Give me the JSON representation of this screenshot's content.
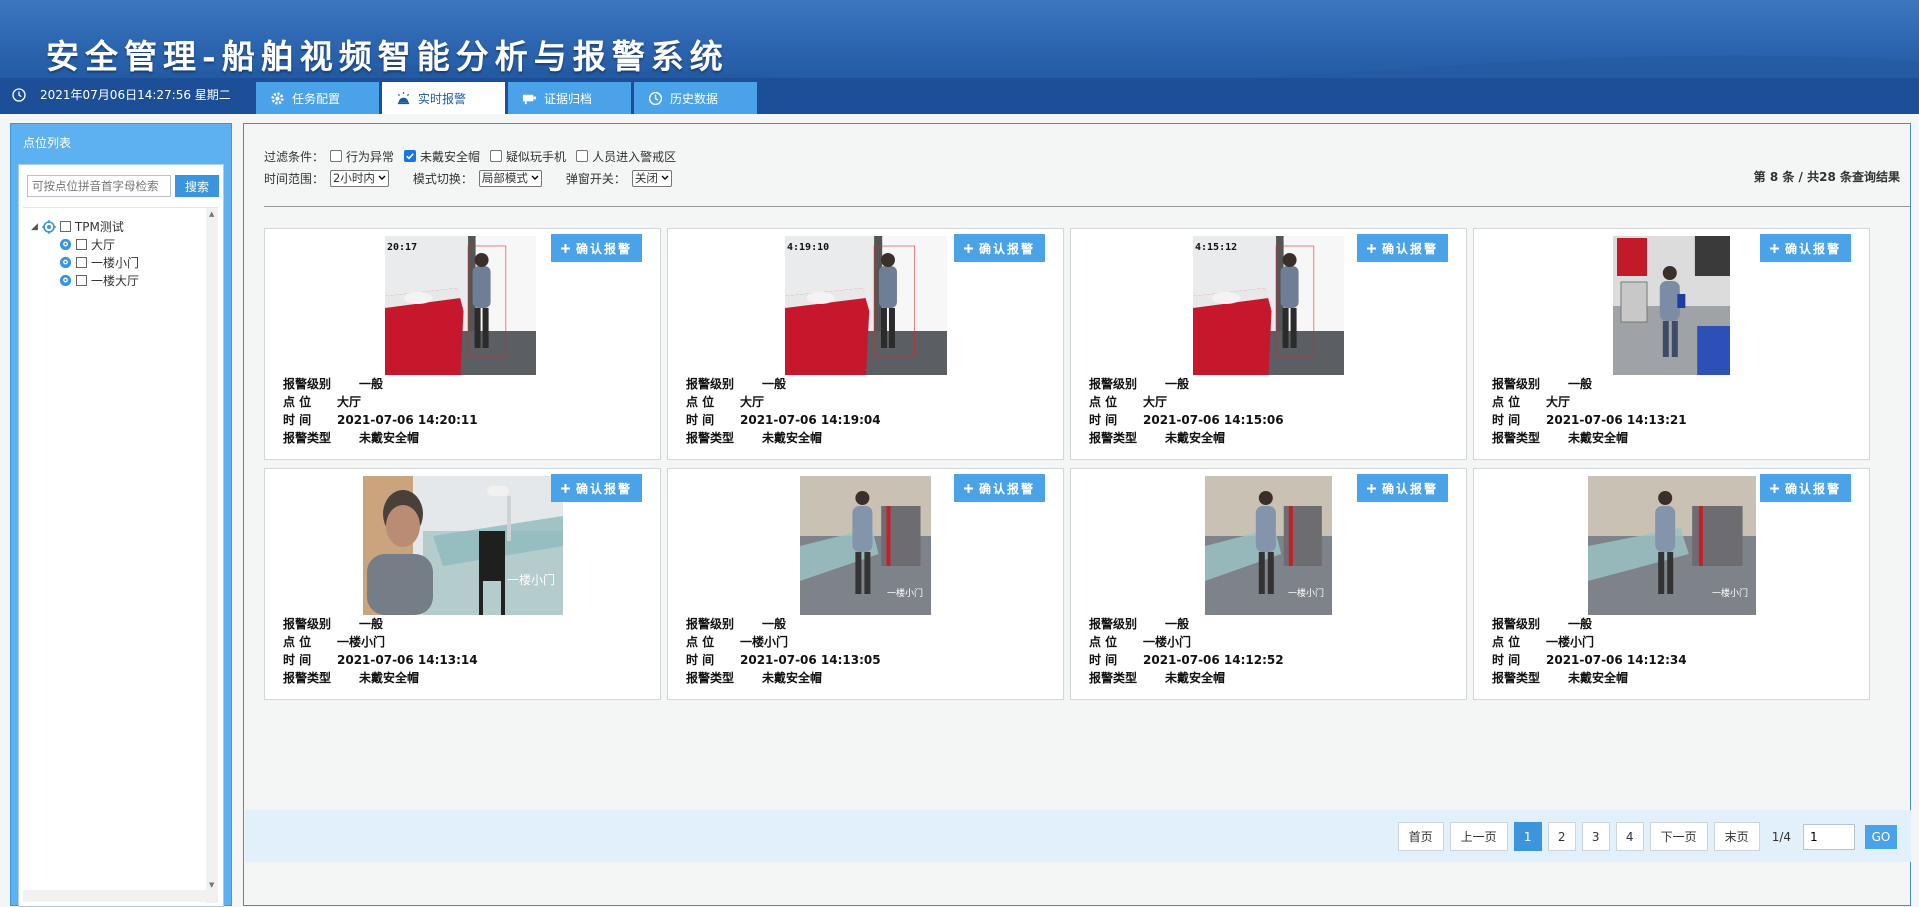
{
  "header": {
    "title": "安全管理-船舶视频智能分析与报警系统",
    "datetime": "2021年07月06日14:27:56 星期二"
  },
  "tabs": [
    {
      "label": "任务配置",
      "icon": "gear-icon"
    },
    {
      "label": "实时报警",
      "icon": "alarm-icon"
    },
    {
      "label": "证据归档",
      "icon": "archive-icon"
    },
    {
      "label": "历史数据",
      "icon": "clock-icon"
    }
  ],
  "sidebar": {
    "title": "点位列表",
    "search_placeholder": "可按点位拼音首字母检索",
    "search_button": "搜索",
    "tree_root": "TPM测试",
    "tree_items": [
      "大厅",
      "一楼小门",
      "一楼大厅"
    ]
  },
  "filters": {
    "label": "过滤条件：",
    "options": [
      {
        "label": "行为异常",
        "checked": false
      },
      {
        "label": "未戴安全帽",
        "checked": true
      },
      {
        "label": "疑似玩手机",
        "checked": false
      },
      {
        "label": "人员进入警戒区",
        "checked": false
      }
    ],
    "time_label": "时间范围：",
    "time_value": "2小时内",
    "mode_label": "模式切换：",
    "mode_value": "局部模式",
    "popup_label": "弹窗开关：",
    "popup_value": "关闭",
    "result_info": "第 8 条 / 共28 条查询结果"
  },
  "card_labels": {
    "confirm": "确认报警",
    "level": "报警级别",
    "location": "点 位",
    "time": "时 间",
    "type": "报警类型"
  },
  "alarms": [
    {
      "level": "一般",
      "location": "大厅",
      "time": "2021-07-06 14:20:11",
      "type": "未戴安全帽",
      "stamp": "20:17"
    },
    {
      "level": "一般",
      "location": "大厅",
      "time": "2021-07-06 14:19:04",
      "type": "未戴安全帽",
      "stamp": "4:19:10"
    },
    {
      "level": "一般",
      "location": "大厅",
      "time": "2021-07-06 14:15:06",
      "type": "未戴安全帽",
      "stamp": "4:15:12"
    },
    {
      "level": "一般",
      "location": "大厅",
      "time": "2021-07-06 14:13:21",
      "type": "未戴安全帽"
    },
    {
      "level": "一般",
      "location": "一楼小门",
      "time": "2021-07-06 14:13:14",
      "type": "未戴安全帽",
      "overlay": "一楼小门"
    },
    {
      "level": "一般",
      "location": "一楼小门",
      "time": "2021-07-06 14:13:05",
      "type": "未戴安全帽",
      "overlay": "一楼小门"
    },
    {
      "level": "一般",
      "location": "一楼小门",
      "time": "2021-07-06 14:12:52",
      "type": "未戴安全帽",
      "overlay": "一楼小门"
    },
    {
      "level": "一般",
      "location": "一楼小门",
      "time": "2021-07-06 14:12:34",
      "type": "未戴安全帽",
      "overlay": "一楼小门"
    }
  ],
  "pager": {
    "first": "首页",
    "prev": "上一页",
    "pages": [
      "1",
      "2",
      "3",
      "4"
    ],
    "current": "1",
    "next": "下一页",
    "last": "末页",
    "page_info": "1/4",
    "goto_value": "1",
    "go": "GO"
  }
}
